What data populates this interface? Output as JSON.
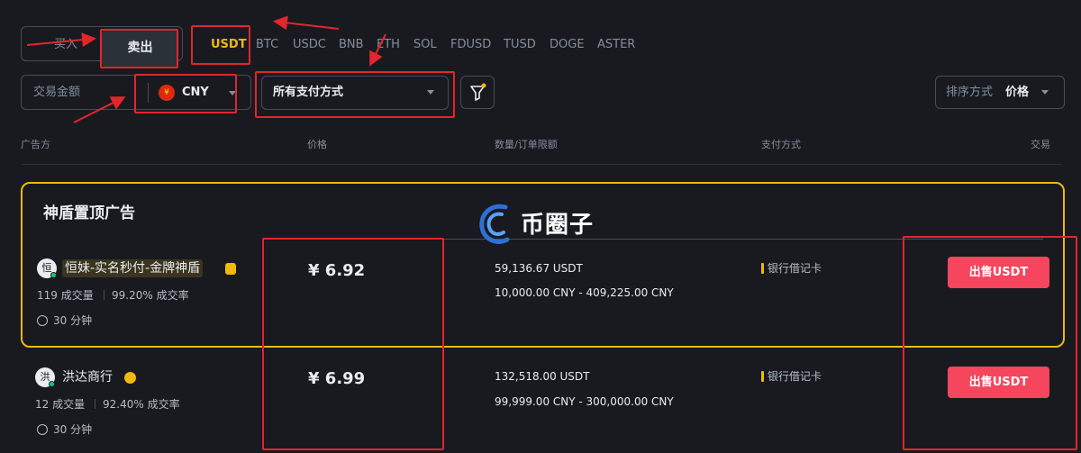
{
  "trade_toggle": {
    "buy_label": "买入",
    "sell_label": "卖出"
  },
  "coins": [
    "USDT",
    "BTC",
    "USDC",
    "BNB",
    "ETH",
    "SOL",
    "FDUSD",
    "TUSD",
    "DOGE",
    "ASTER"
  ],
  "active_coin": "USDT",
  "amount": {
    "label": "交易金额",
    "currency": "CNY",
    "currency_icon": "¥"
  },
  "payment_filter": {
    "selected": "所有支付方式"
  },
  "filter_icon": "filter-icon",
  "sort": {
    "label": "排序方式",
    "value": "价格"
  },
  "table_headers": {
    "advertiser": "广告方",
    "price": "价格",
    "limits": "数量/订单限额",
    "payment": "支付方式",
    "trade": "交易"
  },
  "featured_title": "神盾置顶广告",
  "watermark": "币圈子",
  "ads": [
    {
      "avatar": "恒",
      "name": "恒妹-实名秒付-金牌神盾",
      "trades": "119 成交量",
      "completion": "99.20% 成交率",
      "time": "30 分钟",
      "price": "¥ 6.92",
      "quantity": "59,136.67 USDT",
      "limit": "10,000.00 CNY - 409,225.00 CNY",
      "payment": "银行借记卡",
      "action": "出售USDT"
    },
    {
      "avatar": "洪",
      "name": "洪达商行",
      "trades": "12 成交量",
      "completion": "92.40% 成交率",
      "time": "30 分钟",
      "price": "¥ 6.99",
      "quantity": "132,518.00 USDT",
      "limit": "99,999.00 CNY - 300,000.00 CNY",
      "payment": "银行借记卡",
      "action": "出售USDT"
    }
  ],
  "colors": {
    "accent": "#f0b90b",
    "sell": "#f6465d",
    "background": "#181a20",
    "annotation": "#e2262b"
  }
}
